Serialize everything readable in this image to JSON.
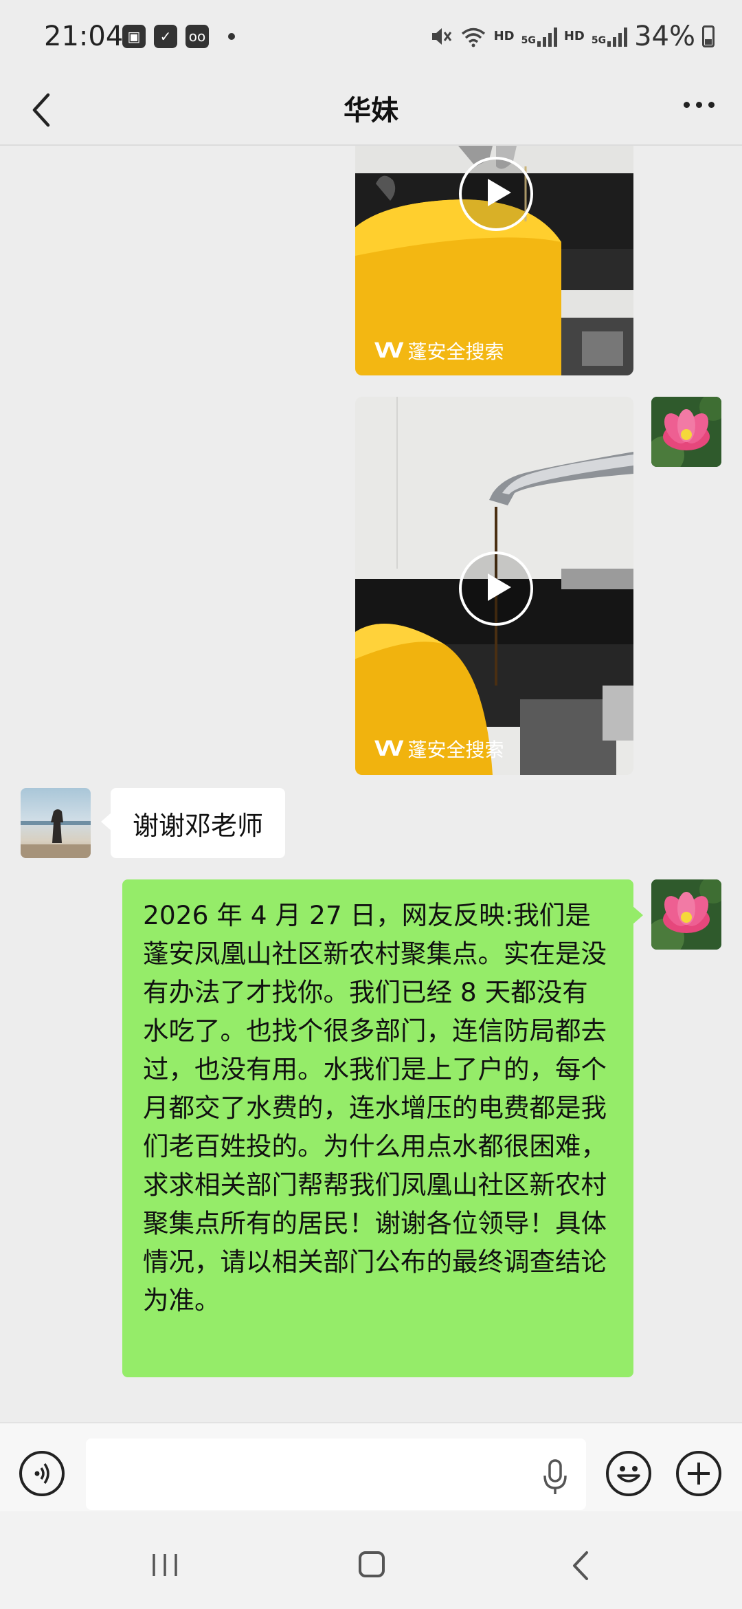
{
  "status_bar": {
    "time": "21:04",
    "left_icons": [
      "image-notification-icon",
      "check-notification-icon",
      "voicemail-icon"
    ],
    "hd_1": "HD",
    "sig_1": "5G",
    "hd_2": "HD",
    "sig_2": "5G",
    "battery": "34%"
  },
  "header": {
    "title": "华妹"
  },
  "messages": [
    {
      "type": "video",
      "side": "right",
      "watermark": "蓬安全搜索"
    },
    {
      "type": "video",
      "side": "right",
      "watermark": "蓬安全搜索"
    },
    {
      "type": "text",
      "side": "left",
      "text": "谢谢邓老师"
    },
    {
      "type": "text",
      "side": "right",
      "text": "2026 年 4 月 27 日，网友反映:我们是蓬安凤凰山社区新农村聚集点。实在是没有办法了才找你。我们已经 8 天都没有水吃了。也找个很多部门，连信防局都去过，也没有用。水我们是上了户的，每个月都交了水费的，连水增压的电费都是我们老百姓投的。为什么用点水都很困难，求求相关部门帮帮我们凤凰山社区新农村聚集点所有的居民！谢谢各位领导！具体情况，请以相关部门公布的最终调查结论为准。"
    }
  ],
  "input": {
    "value": ""
  },
  "colors": {
    "sent_bubble": "#95ec69",
    "received_bubble": "#ffffff",
    "background": "#ededed"
  }
}
